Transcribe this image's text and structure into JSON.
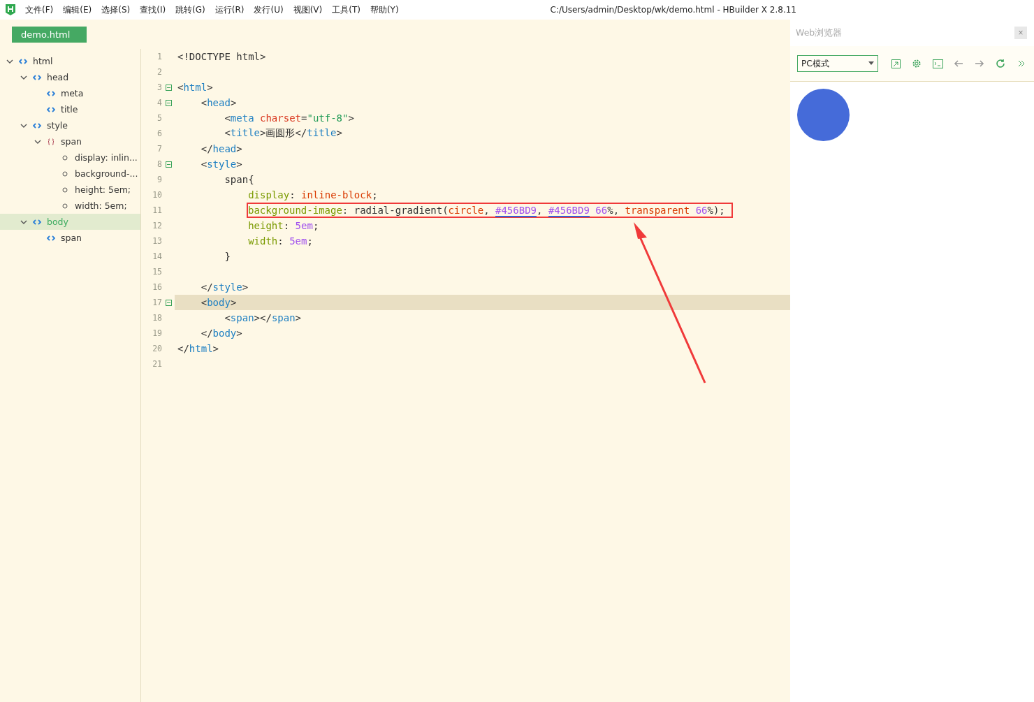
{
  "menu": [
    "文件(F)",
    "编辑(E)",
    "选择(S)",
    "查找(I)",
    "跳转(G)",
    "运行(R)",
    "发行(U)",
    "视图(V)",
    "工具(T)",
    "帮助(Y)"
  ],
  "window": {
    "title": "C:/Users/admin/Desktop/wk/demo.html - HBuilder X 2.8.11"
  },
  "tabs": [
    {
      "label": "demo.html",
      "selected": true
    }
  ],
  "outline": [
    {
      "label": "html",
      "kind": "tag",
      "expanded": true,
      "selected": false,
      "children": [
        {
          "label": "head",
          "kind": "tag",
          "expanded": true,
          "selected": false,
          "children": [
            {
              "label": "meta",
              "kind": "tag",
              "selected": false
            },
            {
              "label": "title",
              "kind": "tag",
              "selected": false
            }
          ]
        },
        {
          "label": "style",
          "kind": "tag",
          "expanded": true,
          "selected": false,
          "children": [
            {
              "label": "span",
              "kind": "rule",
              "expanded": true,
              "selected": false,
              "children": [
                {
                  "label": "display: inlin...",
                  "kind": "decl",
                  "selected": false
                },
                {
                  "label": "background-...",
                  "kind": "decl",
                  "selected": false
                },
                {
                  "label": "height: 5em;",
                  "kind": "decl",
                  "selected": false
                },
                {
                  "label": "width: 5em;",
                  "kind": "decl",
                  "selected": false
                }
              ]
            }
          ]
        },
        {
          "label": "body",
          "kind": "tag",
          "expanded": true,
          "selected": true,
          "children": [
            {
              "label": "span",
              "kind": "tag",
              "selected": false
            }
          ]
        }
      ]
    }
  ],
  "editor": {
    "lines": [
      {
        "no": "1",
        "fold": false,
        "current": false,
        "boxed": false,
        "tokens": [
          {
            "t": "<!DOCTYPE html>",
            "kind": "plain"
          }
        ]
      },
      {
        "no": "2",
        "fold": false,
        "current": false,
        "boxed": false
      },
      {
        "no": "3",
        "fold": true,
        "current": false,
        "boxed": false,
        "tokens": [
          {
            "t": "<",
            "kind": "punct"
          },
          {
            "t": "html",
            "kind": "tag"
          },
          {
            "t": ">",
            "kind": "punct"
          }
        ]
      },
      {
        "no": "4",
        "fold": true,
        "current": false,
        "boxed": false,
        "tokens": [
          {
            "t": "    <",
            "kind": "punct"
          },
          {
            "t": "head",
            "kind": "tag"
          },
          {
            "t": ">",
            "kind": "punct"
          }
        ]
      },
      {
        "no": "5",
        "fold": false,
        "current": false,
        "boxed": false,
        "tokens": [
          {
            "t": "        <",
            "kind": "punct"
          },
          {
            "t": "meta",
            "kind": "tag"
          },
          {
            "t": " charset",
            "kind": "attr"
          },
          {
            "t": "=",
            "kind": "punct"
          },
          {
            "t": "\"utf-8\"",
            "kind": "string"
          },
          {
            "t": ">",
            "kind": "punct"
          }
        ]
      },
      {
        "no": "6",
        "fold": false,
        "current": false,
        "boxed": false,
        "tokens": [
          {
            "t": "        <",
            "kind": "punct"
          },
          {
            "t": "title",
            "kind": "tag"
          },
          {
            "t": ">画圆形</",
            "kind": "punct"
          },
          {
            "t": "title",
            "kind": "tag"
          },
          {
            "t": ">",
            "kind": "punct"
          }
        ]
      },
      {
        "no": "7",
        "fold": false,
        "current": false,
        "boxed": false,
        "tokens": [
          {
            "t": "    </",
            "kind": "punct"
          },
          {
            "t": "head",
            "kind": "tag"
          },
          {
            "t": ">",
            "kind": "punct"
          }
        ]
      },
      {
        "no": "8",
        "fold": true,
        "current": false,
        "boxed": false,
        "tokens": [
          {
            "t": "    <",
            "kind": "punct"
          },
          {
            "t": "style",
            "kind": "tag"
          },
          {
            "t": ">",
            "kind": "punct"
          }
        ]
      },
      {
        "no": "9",
        "fold": false,
        "current": false,
        "boxed": false,
        "tokens": [
          {
            "t": "        span{",
            "kind": "punct"
          }
        ]
      },
      {
        "no": "10",
        "fold": false,
        "current": false,
        "boxed": false,
        "tokens": [
          {
            "t": "            display",
            "kind": "prop"
          },
          {
            "t": ": ",
            "kind": "punct"
          },
          {
            "t": "inline-block",
            "kind": "value"
          },
          {
            "t": ";",
            "kind": "punct"
          }
        ]
      },
      {
        "no": "11",
        "fold": false,
        "current": false,
        "boxed": true,
        "tokens": [
          {
            "t": "background-image",
            "kind": "prop"
          },
          {
            "t": ": radial-gradient(",
            "kind": "punct"
          },
          {
            "t": "circle",
            "kind": "value"
          },
          {
            "t": ", ",
            "kind": "punct"
          },
          {
            "t": "#456BD9",
            "kind": "color"
          },
          {
            "t": ", ",
            "kind": "punct"
          },
          {
            "t": "#456BD9",
            "kind": "color"
          },
          {
            "t": " 66",
            "kind": "number"
          },
          {
            "t": "%, ",
            "kind": "punct"
          },
          {
            "t": "transparent",
            "kind": "value"
          },
          {
            "t": " 66",
            "kind": "number"
          },
          {
            "t": "%);",
            "kind": "punct"
          }
        ]
      },
      {
        "no": "12",
        "fold": false,
        "current": false,
        "boxed": false,
        "tokens": [
          {
            "t": "            height",
            "kind": "prop"
          },
          {
            "t": ": ",
            "kind": "punct"
          },
          {
            "t": "5em",
            "kind": "number"
          },
          {
            "t": ";",
            "kind": "punct"
          }
        ]
      },
      {
        "no": "13",
        "fold": false,
        "current": false,
        "boxed": false,
        "tokens": [
          {
            "t": "            width",
            "kind": "prop"
          },
          {
            "t": ": ",
            "kind": "punct"
          },
          {
            "t": "5em",
            "kind": "number"
          },
          {
            "t": ";",
            "kind": "punct"
          }
        ]
      },
      {
        "no": "14",
        "fold": false,
        "current": false,
        "boxed": false,
        "tokens": [
          {
            "t": "        }",
            "kind": "punct"
          }
        ]
      },
      {
        "no": "15",
        "fold": false,
        "current": false,
        "boxed": false
      },
      {
        "no": "16",
        "fold": false,
        "current": false,
        "boxed": false,
        "tokens": [
          {
            "t": "    </",
            "kind": "punct"
          },
          {
            "t": "style",
            "kind": "tag"
          },
          {
            "t": ">",
            "kind": "punct"
          }
        ]
      },
      {
        "no": "17",
        "fold": true,
        "current": true,
        "boxed": false,
        "tokens": [
          {
            "t": "    <",
            "kind": "punct"
          },
          {
            "t": "body",
            "kind": "tag"
          },
          {
            "t": ">",
            "kind": "punct"
          }
        ]
      },
      {
        "no": "18",
        "fold": false,
        "current": false,
        "boxed": false,
        "tokens": [
          {
            "t": "        <",
            "kind": "punct"
          },
          {
            "t": "span",
            "kind": "tag"
          },
          {
            "t": "></",
            "kind": "punct"
          },
          {
            "t": "span",
            "kind": "tag"
          },
          {
            "t": ">",
            "kind": "punct"
          }
        ]
      },
      {
        "no": "19",
        "fold": false,
        "current": false,
        "boxed": false,
        "tokens": [
          {
            "t": "    </",
            "kind": "punct"
          },
          {
            "t": "body",
            "kind": "tag"
          },
          {
            "t": ">",
            "kind": "punct"
          }
        ]
      },
      {
        "no": "20",
        "fold": false,
        "current": false,
        "boxed": false,
        "tokens": [
          {
            "t": "</",
            "kind": "punct"
          },
          {
            "t": "html",
            "kind": "tag"
          },
          {
            "t": ">",
            "kind": "punct"
          }
        ]
      },
      {
        "no": "21",
        "fold": false,
        "current": false,
        "boxed": false
      }
    ]
  },
  "browser": {
    "title": "Web浏览器",
    "close": "×",
    "mode": {
      "value": "PC模式"
    },
    "circle": {
      "color": "#456bd9"
    }
  }
}
